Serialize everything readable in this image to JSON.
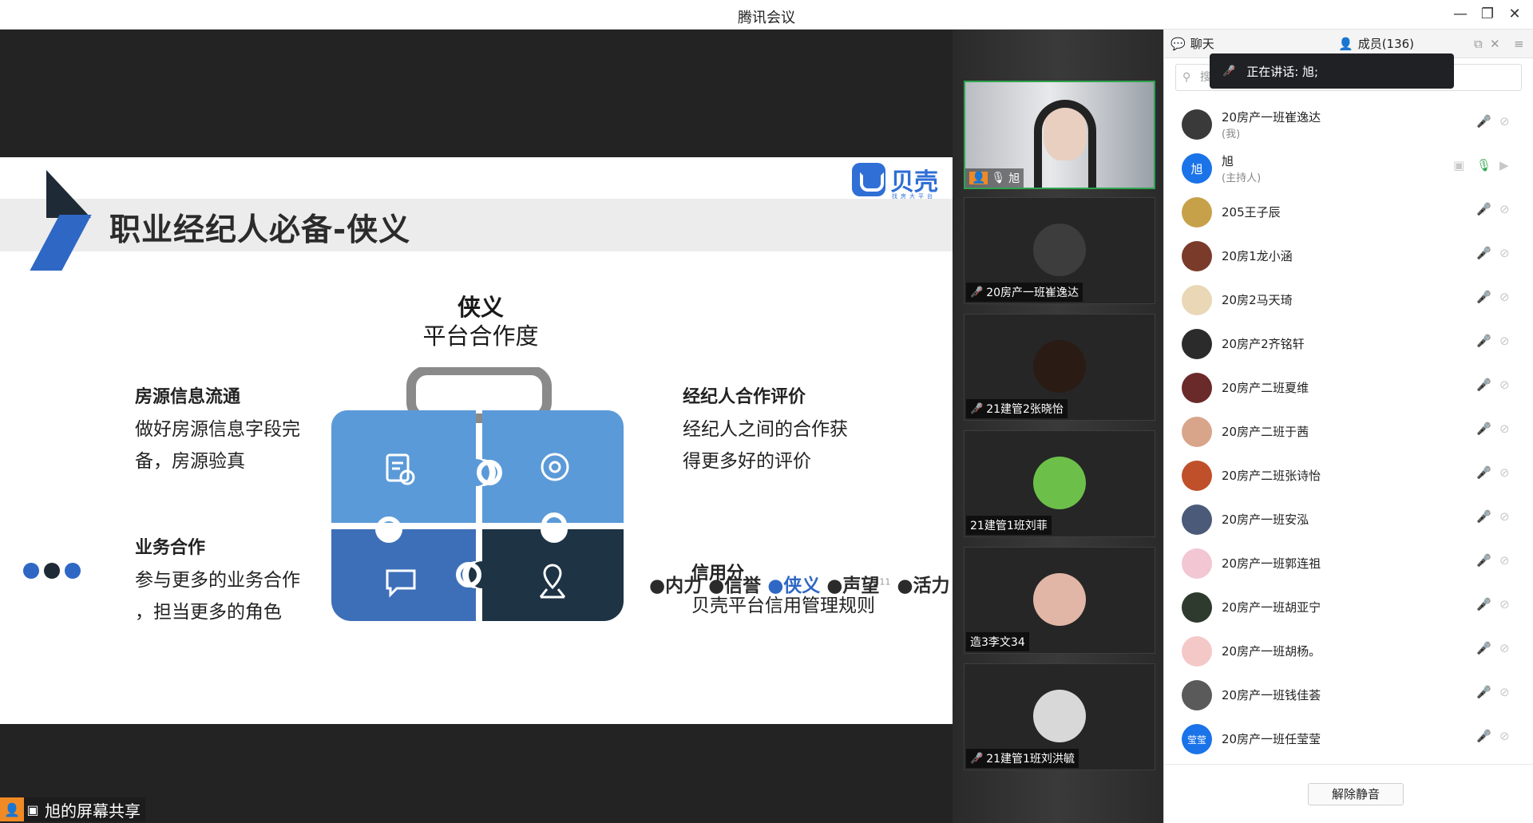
{
  "app": {
    "title": "腾讯会议",
    "window_controls": {
      "minimize": "—",
      "restore": "❐",
      "close": "✕"
    }
  },
  "slide": {
    "title": "职业经纪人必备-侠义",
    "logo_text": "贝壳",
    "logo_sub": "找房大平台",
    "center_title": "侠义",
    "center_sub": "平台合作度",
    "features": [
      {
        "heading": "房源信息流通",
        "lines": [
          "做好房源信息字段完",
          "备，房源验真"
        ]
      },
      {
        "heading": "业务合作",
        "lines": [
          "参与更多的业务合作",
          "，担当更多的角色"
        ]
      },
      {
        "heading": "经纪人合作评价",
        "lines": [
          "经纪人之间的合作获",
          "得更多好的评价"
        ]
      },
      {
        "heading": "信用分",
        "lines": [
          "贝壳平台信用管理规则"
        ]
      }
    ],
    "footer_nav": [
      "●内力",
      "●信誉",
      "●侠义",
      "●声望",
      "●活力"
    ],
    "footer_active": 2,
    "page_superscript": "11",
    "colors": {
      "blue": "#2f67c4",
      "light_blue": "#5b9ad8",
      "mid_blue": "#3d6fb8",
      "dark": "#1e3344"
    }
  },
  "share_badge": {
    "label": "旭的屏幕共享"
  },
  "video_tiles": [
    {
      "name": "旭",
      "speaking": true,
      "mic": "on"
    },
    {
      "name": "20房产一班崔逸达",
      "mic": "off"
    },
    {
      "name": "21建管2张晓怡",
      "mic": "off"
    },
    {
      "name": "21建管1班刘菲",
      "mic": "none"
    },
    {
      "name": "造3李文34",
      "mic": "none"
    },
    {
      "name": "21建管1班刘洪毓",
      "mic": "off"
    }
  ],
  "panel": {
    "tab_chat": "聊天",
    "tab_members": "成员(136)",
    "search_placeholder": "搜",
    "toast": "正在讲话: 旭;",
    "unmute_button": "解除静音",
    "members": [
      {
        "name": "20房产一班崔逸达",
        "role": "(我)",
        "avatar": "#3a3a3a"
      },
      {
        "name": "旭",
        "role": "(主持人)",
        "avatar": "#1a73e8",
        "avatar_text": "旭",
        "host": true
      },
      {
        "name": "205王子辰",
        "avatar": "#c7a14a"
      },
      {
        "name": "20房1龙小涵",
        "avatar": "#7a3b2b"
      },
      {
        "name": "20房2马天琦",
        "avatar": "#e9d7b6"
      },
      {
        "name": "20房产2齐铭轩",
        "avatar": "#2b2b2b"
      },
      {
        "name": "20房产二班夏维",
        "avatar": "#6a2a2a"
      },
      {
        "name": "20房产二班于茜",
        "avatar": "#d8a58a"
      },
      {
        "name": "20房产二班张诗怡",
        "avatar": "#c0502a"
      },
      {
        "name": "20房产一班安泓",
        "avatar": "#4a5a78"
      },
      {
        "name": "20房产一班郭连祖",
        "avatar": "#f2c6d2"
      },
      {
        "name": "20房产一班胡亚宁",
        "avatar": "#2e3a2e"
      },
      {
        "name": "20房产一班胡杨。",
        "avatar": "#f5c8c8"
      },
      {
        "name": "20房产一班钱佳荟",
        "avatar": "#5a5a5a"
      },
      {
        "name": "20房产一班任莹莹",
        "avatar": "#1a73e8",
        "avatar_text": "莹莹"
      }
    ]
  }
}
